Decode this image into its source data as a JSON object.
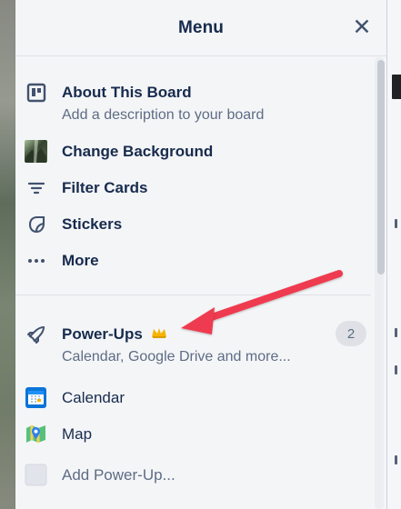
{
  "menu": {
    "title": "Menu",
    "close_icon": "close-icon",
    "items": [
      {
        "label": "About This Board",
        "sublabel": "Add a description to your board",
        "icon": "board-icon"
      },
      {
        "label": "Change Background",
        "icon": "background-thumbnail-icon"
      },
      {
        "label": "Filter Cards",
        "icon": "filter-icon"
      },
      {
        "label": "Stickers",
        "icon": "sticker-icon"
      },
      {
        "label": "More",
        "icon": "more-icon"
      }
    ],
    "powerups": {
      "label": "Power-Ups",
      "sublabel": "Calendar, Google Drive and more...",
      "count": "2",
      "icon": "rocket-icon",
      "crown_icon": "crown-icon",
      "items": [
        {
          "label": "Calendar",
          "icon": "calendar-icon"
        },
        {
          "label": "Map",
          "icon": "map-icon"
        },
        {
          "label": "Add Power-Up...",
          "icon": "add-power-up-icon"
        }
      ]
    }
  },
  "colors": {
    "panel": "#f4f5f7",
    "text": "#172b4d",
    "muted": "#5e6c84",
    "divider": "#dfe1e6",
    "annotation_arrow": "#ef3b4f",
    "crown": "#f5b400"
  }
}
